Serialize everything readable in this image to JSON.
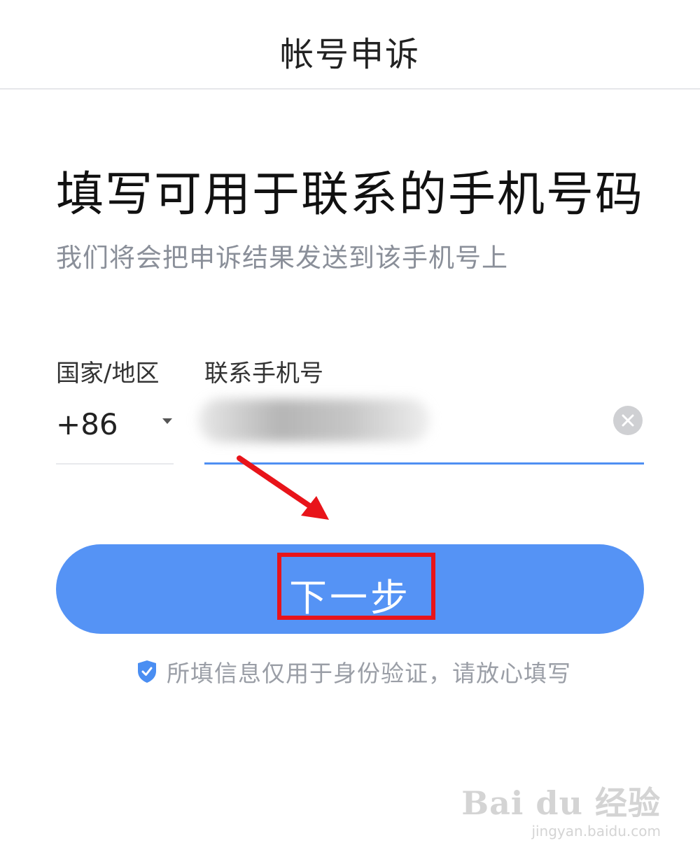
{
  "header": {
    "title": "帐号申诉"
  },
  "main": {
    "heading": "填写可用于联系的手机号码",
    "subheading": "我们将会把申诉结果发送到该手机号上"
  },
  "form": {
    "country_label": "国家/地区",
    "country_code": "+86",
    "phone_label": "联系手机号",
    "phone_value": ""
  },
  "next_button": {
    "label": "下一步"
  },
  "hint": {
    "text": "所填信息仅用于身份验证，请放心填写"
  },
  "watermark": {
    "logo": "Bai du 经验",
    "url": "jingyan.baidu.com"
  },
  "colors": {
    "accent": "#5593f5",
    "input_underline": "#4f8ff2",
    "annotation": "#e8141a",
    "hint_text": "#9a9ea6"
  }
}
